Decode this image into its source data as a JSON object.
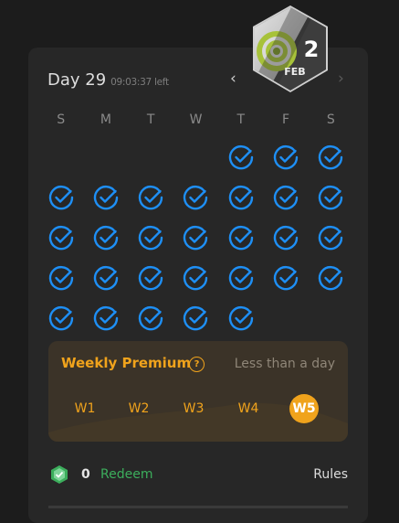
{
  "header": {
    "day_title": "Day 29",
    "time_left": "09:03:37 left",
    "prev_icon": "‹",
    "next_icon": "›"
  },
  "badge": {
    "day": "2",
    "month": "FEB"
  },
  "weekdays": [
    "S",
    "M",
    "T",
    "W",
    "T",
    "F",
    "S"
  ],
  "calendar": {
    "rows": [
      [
        false,
        false,
        false,
        false,
        true,
        true,
        true
      ],
      [
        true,
        true,
        true,
        true,
        true,
        true,
        true
      ],
      [
        true,
        true,
        true,
        true,
        true,
        true,
        true
      ],
      [
        true,
        true,
        true,
        true,
        true,
        true,
        true
      ],
      [
        true,
        true,
        true,
        true,
        true,
        false,
        false
      ]
    ],
    "check_color": "#1e8ff5"
  },
  "premium": {
    "title": "Weekly Premium",
    "help_icon": "?",
    "status": "Less than a day",
    "weeks": [
      "W1",
      "W2",
      "W3",
      "W4",
      "W5"
    ],
    "active_week": 4,
    "accent": "#f0a31c"
  },
  "footer": {
    "points": "0",
    "redeem_label": "Redeem",
    "rules_label": "Rules",
    "gem_color": "#3cae5c"
  }
}
